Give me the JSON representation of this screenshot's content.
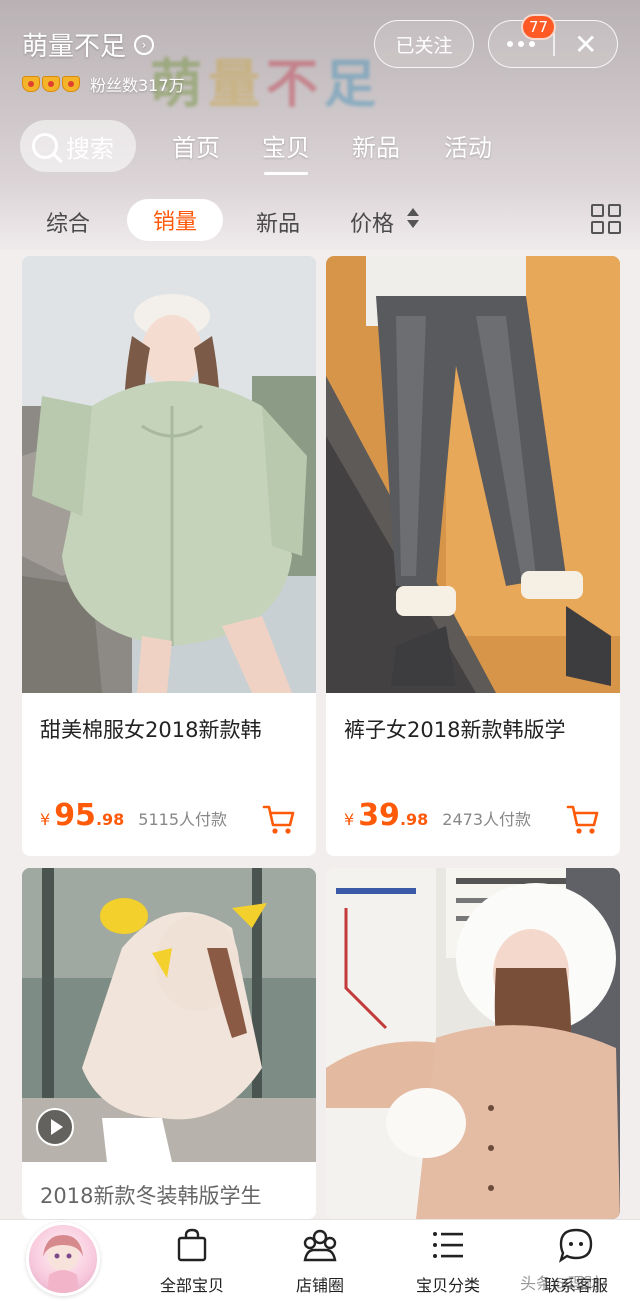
{
  "header": {
    "store_name": "萌量不足",
    "follower_label": "粉丝数317万",
    "follow_button": "已关注",
    "notification_count": "77"
  },
  "nav": {
    "search_label": "搜索",
    "tabs": [
      {
        "label": "首页",
        "active": false
      },
      {
        "label": "宝贝",
        "active": true
      },
      {
        "label": "新品",
        "active": false
      },
      {
        "label": "活动",
        "active": false
      }
    ]
  },
  "sort": {
    "items": [
      "综合",
      "销量",
      "新品",
      "价格"
    ],
    "active": "销量"
  },
  "products": [
    {
      "title": "甜美棉服女2018新款韩",
      "currency": "¥",
      "price_int": "95",
      "price_dec": ".98",
      "sold": "5115人付款",
      "photo_colors": [
        "#c7cfc0",
        "#a8b5a2"
      ]
    },
    {
      "title": "裤子女2018新款韩版学",
      "currency": "¥",
      "price_int": "39",
      "price_dec": ".98",
      "sold": "2473人付款",
      "photo_colors": [
        "#e6a648",
        "#5b5f66"
      ]
    },
    {
      "title": "2018新款冬装韩版学生",
      "photo_colors": [
        "#8d9a92",
        "#f2e6de"
      ]
    },
    {
      "title": "",
      "photo_colors": [
        "#e9e6e0",
        "#e3c0a8"
      ]
    }
  ],
  "bottom_bar": {
    "items": [
      {
        "label": "全部宝贝",
        "icon": "shopping-bag-icon"
      },
      {
        "label": "店铺圈",
        "icon": "group-icon"
      },
      {
        "label": "宝贝分类",
        "icon": "list-icon"
      },
      {
        "label": "联系客服",
        "icon": "chat-bubble-icon"
      }
    ]
  },
  "watermark": "头条@理财"
}
